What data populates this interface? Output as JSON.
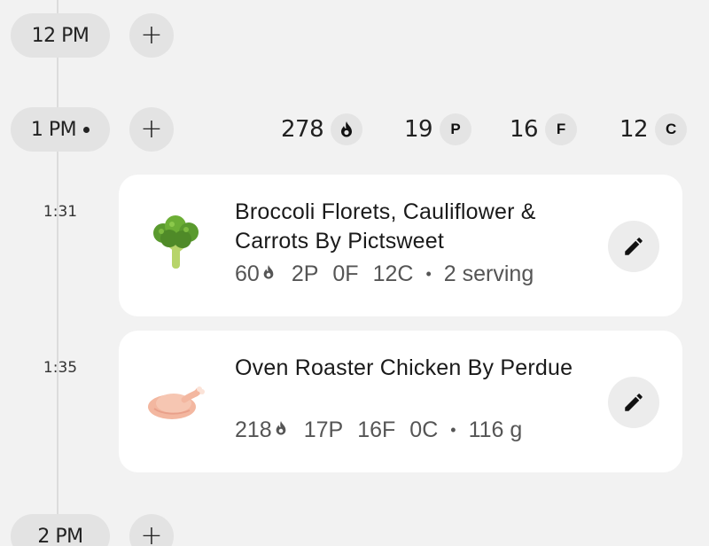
{
  "timeline": {
    "hours": [
      {
        "label": "12 PM",
        "current": false
      },
      {
        "label": "1 PM",
        "current": true
      },
      {
        "label": "2 PM",
        "current": false
      }
    ],
    "add_label": "+"
  },
  "summary": {
    "calories": "278",
    "protein": "19",
    "fat": "16",
    "carbs": "12",
    "protein_badge": "P",
    "fat_badge": "F",
    "carbs_badge": "C"
  },
  "entries": [
    {
      "time": "1:31",
      "name": "Broccoli Florets, Cauliflower & Carrots By Pictsweet",
      "calories": "60",
      "protein": "2P",
      "fat": "0F",
      "carbs": "12C",
      "separator": "•",
      "amount": "2 serving",
      "icon": "broccoli-icon"
    },
    {
      "time": "1:35",
      "name": "Oven Roaster Chicken By Perdue",
      "calories": "218",
      "protein": "17P",
      "fat": "16F",
      "carbs": "0C",
      "separator": "•",
      "amount": "116 g",
      "icon": "roast-chicken-icon"
    }
  ],
  "colors": {
    "background": "#f2f2f2",
    "pill": "#e3e3e3",
    "card": "#ffffff"
  }
}
